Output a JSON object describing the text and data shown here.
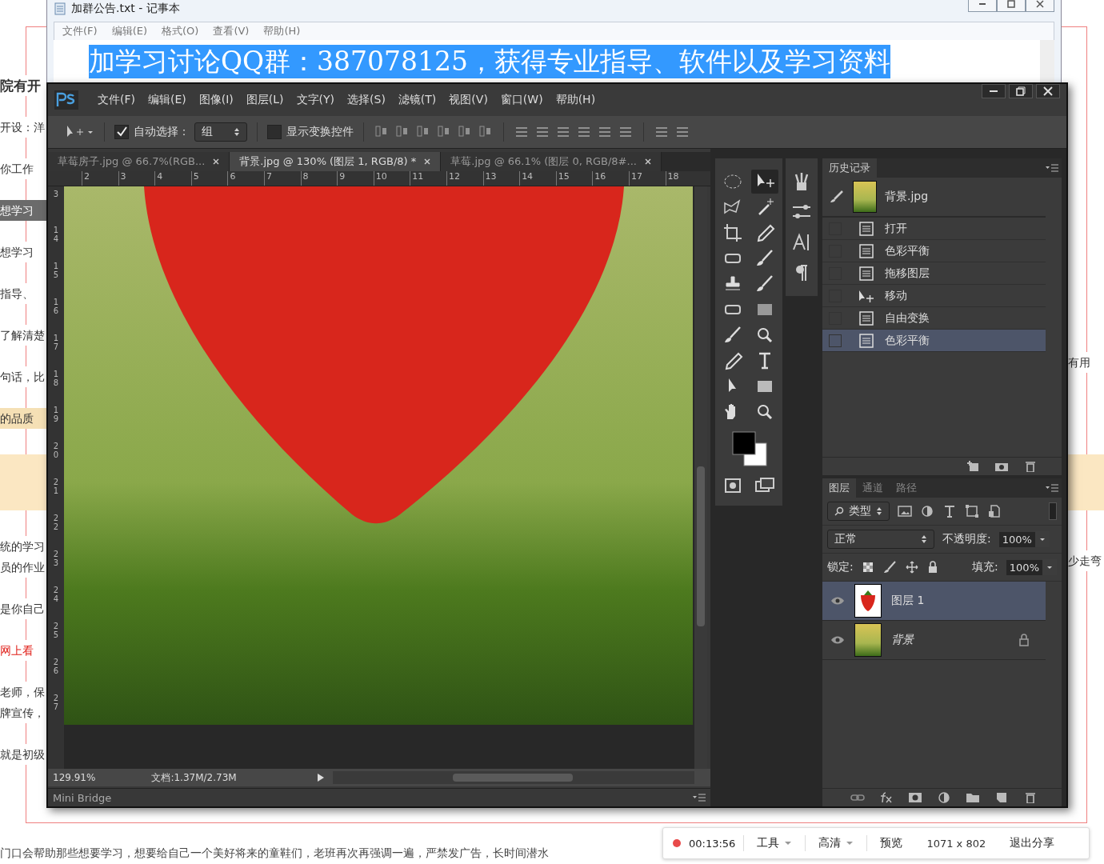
{
  "web_page": {
    "left_paragraphs": [
      {
        "kind": "heading",
        "lines": [
          "院有开"
        ]
      },
      {
        "kind": "plain",
        "lines": [
          "开设：洋"
        ]
      },
      {
        "kind": "plain",
        "lines": [
          "你工作"
        ]
      },
      {
        "kind": "dark",
        "lines": [
          "想学习"
        ]
      },
      {
        "kind": "plain",
        "lines": [
          "想学习"
        ]
      },
      {
        "kind": "plain",
        "lines": [
          "指导、"
        ]
      },
      {
        "kind": "plain",
        "lines": [
          "了解清楚"
        ]
      },
      {
        "kind": "plain",
        "lines": [
          "句话，比"
        ]
      },
      {
        "kind": "tan",
        "lines": [
          "的品质"
        ]
      },
      {
        "kind": "band"
      },
      {
        "kind": "plain",
        "lines": [
          "统的学习",
          "员的作业"
        ]
      },
      {
        "kind": "plain",
        "lines": [
          "是你自己"
        ]
      },
      {
        "kind": "red",
        "lines": [
          "网上看"
        ]
      },
      {
        "kind": "plain",
        "lines": [
          "老师，保",
          "牌宣传，"
        ]
      },
      {
        "kind": "plain",
        "lines": [
          "就是初级"
        ]
      }
    ],
    "right_fragments": [
      "有用",
      "少走弯"
    ],
    "bottom_text": "门口会帮助那些想要学习，想要给自己一个美好将来的童鞋们，老班再次再强调一遍，严禁发广告，长时间潜水"
  },
  "notepad": {
    "title": "加群公告.txt - 记事本",
    "menu": [
      "文件(F)",
      "编辑(E)",
      "格式(O)",
      "查看(V)",
      "帮助(H)"
    ],
    "selected_text": "加学习讨论QQ群：387078125，获得专业指导、软件以及学习资料"
  },
  "photoshop": {
    "menu": [
      "文件(F)",
      "编辑(E)",
      "图像(I)",
      "图层(L)",
      "文字(Y)",
      "选择(S)",
      "滤镜(T)",
      "视图(V)",
      "窗口(W)",
      "帮助(H)"
    ],
    "options": {
      "auto_select_checked": true,
      "auto_select_label": "自动选择：",
      "auto_select_value": "组",
      "transform_checked": false,
      "transform_label": "显示变换控件"
    },
    "tabs": [
      {
        "label": "草莓房子.jpg @ 66.7%(RGB...",
        "selected": false
      },
      {
        "label": "背景.jpg @ 130% (图层 1, RGB/8) *",
        "selected": true
      },
      {
        "label": "草莓.jpg @ 66.1% (图层 0, RGB/8#...",
        "selected": false
      }
    ],
    "ruler_h": [
      "2",
      "3",
      "4",
      "5",
      "6",
      "7",
      "8",
      "9",
      "10",
      "11",
      "12",
      "13",
      "14",
      "15",
      "16",
      "17",
      "18"
    ],
    "ruler_v": [
      "3",
      "14",
      "15",
      "16",
      "17",
      "18",
      "19",
      "20",
      "21",
      "22",
      "23",
      "24",
      "25",
      "26",
      "27"
    ],
    "status": {
      "zoom": "129.91%",
      "doc": "文档:1.37M/2.73M"
    },
    "bottom_tab": "Mini Bridge",
    "history": {
      "title": "历史记录",
      "snapshot": "背景.jpg",
      "items": [
        {
          "label": "打开",
          "kind": "doc",
          "selected": false
        },
        {
          "label": "色彩平衡",
          "kind": "doc",
          "selected": false
        },
        {
          "label": "拖移图层",
          "kind": "doc",
          "selected": false
        },
        {
          "label": "移动",
          "kind": "move",
          "selected": false
        },
        {
          "label": "自由变换",
          "kind": "doc",
          "selected": false
        },
        {
          "label": "色彩平衡",
          "kind": "doc",
          "selected": true
        }
      ]
    },
    "layers": {
      "tabs": [
        {
          "label": "图层",
          "selected": true
        },
        {
          "label": "通道",
          "selected": false
        },
        {
          "label": "路径",
          "selected": false
        }
      ],
      "filter": "类型",
      "blend": "正常",
      "opacity_label": "不透明度:",
      "opacity": "100%",
      "lock_label": "锁定:",
      "fill_label": "填充:",
      "fill": "100%",
      "items": [
        {
          "name": "图层 1",
          "kind": "strawberry",
          "selected": true,
          "visible": true,
          "locked": false
        },
        {
          "name": "背景",
          "kind": "background",
          "selected": false,
          "visible": true,
          "locked": true
        }
      ]
    }
  },
  "recorder": {
    "recording": true,
    "time": "00:13:56",
    "tools": "工具",
    "quality": "高清",
    "preview": "预览",
    "size": "1071 x 802",
    "exit": "退出分享"
  }
}
